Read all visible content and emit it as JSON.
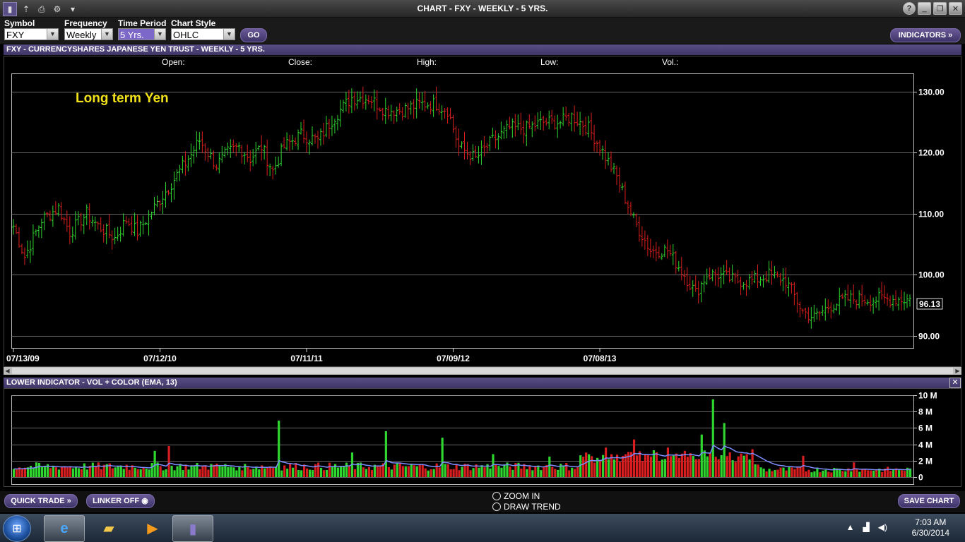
{
  "window": {
    "title": "CHART - FXY - WEEKLY - 5 YRS."
  },
  "toolbar": {
    "symbol_label": "Symbol",
    "symbol_value": "FXY",
    "frequency_label": "Frequency",
    "frequency_value": "Weekly",
    "period_label": "Time Period",
    "period_value": "5 Yrs.",
    "style_label": "Chart Style",
    "style_value": "OHLC",
    "go_label": "GO",
    "indicators_label": "INDICATORS »"
  },
  "main_panel": {
    "header": "FXY - CURRENCYSHARES JAPANESE YEN TRUST - WEEKLY - 5 YRS.",
    "open_label": "Open:",
    "close_label": "Close:",
    "high_label": "High:",
    "low_label": "Low:",
    "vol_label": "Vol.:",
    "annotation": "Long term Yen",
    "last_price": "96.13"
  },
  "lower_panel": {
    "header": "LOWER INDICATOR - VOL + COLOR (EMA, 13)",
    "close_icon": "close-icon"
  },
  "bottom": {
    "quick_trade": "QUICK TRADE »",
    "linker": "LINKER OFF",
    "zoom_in": "ZOOM IN",
    "draw_trend": "DRAW TREND",
    "save_chart": "SAVE CHART"
  },
  "taskbar": {
    "time": "7:03 AM",
    "date": "6/30/2014"
  },
  "colors": {
    "up": "#2fd62f",
    "down": "#d81e1e",
    "ema": "#7d8cff",
    "grid": "#8a8a8a",
    "panel": "#4b4276",
    "annotation": "#f2e21a"
  },
  "chart_data": [
    {
      "type": "ohlc",
      "title": "FXY - CURRENCYSHARES JAPANESE YEN TRUST - WEEKLY - 5 YRS.",
      "x_tick_labels": [
        "07/13/09",
        "07/12/10",
        "07/11/11",
        "07/09/12",
        "07/08/13"
      ],
      "y_tick_labels": [
        "130.00",
        "120.00",
        "110.00",
        "100.00",
        "90.00"
      ],
      "ylim": [
        88,
        133
      ],
      "grid": true,
      "annotation": "Long term Yen",
      "last": 96.13,
      "anchors_week_close": [
        [
          0,
          108
        ],
        [
          4,
          103
        ],
        [
          10,
          109
        ],
        [
          16,
          111
        ],
        [
          20,
          107
        ],
        [
          26,
          110
        ],
        [
          30,
          108
        ],
        [
          36,
          106
        ],
        [
          40,
          109
        ],
        [
          44,
          107
        ],
        [
          50,
          111
        ],
        [
          56,
          115
        ],
        [
          62,
          119
        ],
        [
          66,
          122
        ],
        [
          72,
          118
        ],
        [
          76,
          120
        ],
        [
          80,
          121
        ],
        [
          84,
          119
        ],
        [
          88,
          121
        ],
        [
          92,
          117
        ],
        [
          96,
          121
        ],
        [
          102,
          123
        ],
        [
          108,
          122
        ],
        [
          114,
          126
        ],
        [
          120,
          129
        ],
        [
          126,
          129
        ],
        [
          132,
          127
        ],
        [
          138,
          127
        ],
        [
          144,
          128
        ],
        [
          150,
          128
        ],
        [
          154,
          127
        ],
        [
          158,
          121
        ],
        [
          164,
          119
        ],
        [
          170,
          122
        ],
        [
          176,
          124
        ],
        [
          182,
          124
        ],
        [
          188,
          125
        ],
        [
          194,
          125
        ],
        [
          198,
          126
        ],
        [
          204,
          124
        ],
        [
          208,
          121
        ],
        [
          214,
          116
        ],
        [
          220,
          109
        ],
        [
          226,
          104
        ],
        [
          232,
          104
        ],
        [
          238,
          100
        ],
        [
          242,
          97
        ],
        [
          246,
          100
        ],
        [
          250,
          100
        ],
        [
          256,
          99
        ],
        [
          262,
          99
        ],
        [
          268,
          100
        ],
        [
          274,
          99
        ],
        [
          280,
          94
        ],
        [
          284,
          93
        ],
        [
          290,
          95
        ],
        [
          296,
          96
        ],
        [
          302,
          96
        ],
        [
          308,
          96
        ],
        [
          314,
          96
        ],
        [
          318,
          96
        ]
      ]
    },
    {
      "type": "bar",
      "title": "LOWER INDICATOR - VOL + COLOR (EMA, 13)",
      "y_tick_labels": [
        "10 M",
        "8 M",
        "6 M",
        "4 M",
        "2 M",
        "0"
      ],
      "ylim": [
        0,
        10
      ],
      "series": [
        {
          "name": "VOL"
        },
        {
          "name": "EMA, 13"
        }
      ],
      "spikes_millions": [
        [
          0,
          1
        ],
        [
          15,
          1.2
        ],
        [
          40,
          1.5
        ],
        [
          50,
          3.2
        ],
        [
          55,
          3.8
        ],
        [
          70,
          1.6
        ],
        [
          80,
          1.3
        ],
        [
          94,
          6.9
        ],
        [
          120,
          3
        ],
        [
          132,
          5.6
        ],
        [
          152,
          4.8
        ],
        [
          170,
          2.8
        ],
        [
          190,
          2.5
        ],
        [
          210,
          3.6
        ],
        [
          220,
          4.6
        ],
        [
          232,
          3.6
        ],
        [
          238,
          3.2
        ],
        [
          244,
          5.2
        ],
        [
          248,
          9.5
        ],
        [
          252,
          6.6
        ],
        [
          262,
          3.4
        ],
        [
          280,
          2.6
        ],
        [
          298,
          1.8
        ]
      ]
    }
  ]
}
